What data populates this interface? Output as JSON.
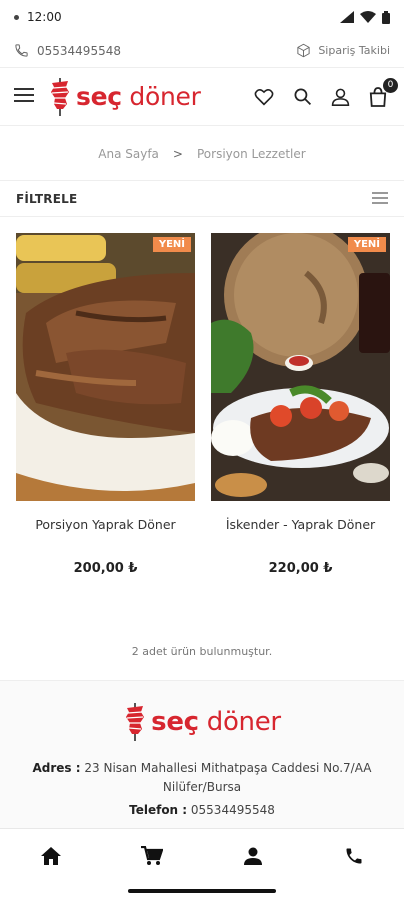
{
  "status_bar": {
    "time": "12:00"
  },
  "topline": {
    "phone": "05534495548",
    "track_label": "Sipariş Takibi"
  },
  "header": {
    "logo_bold": "seç",
    "logo_rest": "döner",
    "cart_count": "0",
    "icons": [
      "menu-icon",
      "heart-icon",
      "search-icon",
      "user-icon",
      "cart-icon"
    ]
  },
  "breadcrumb": {
    "home": "Ana Sayfa",
    "separator": ">",
    "current": "Porsiyon Lezzetler"
  },
  "filter": {
    "label": "FİLTRELE"
  },
  "products": [
    {
      "badge": "YENİ",
      "name": "Porsiyon Yaprak Döner",
      "price": "200,00 ₺"
    },
    {
      "badge": "YENİ",
      "name": "İskender - Yaprak Döner",
      "price": "220,00 ₺"
    }
  ],
  "result_count": "2 adet ürün bulunmuştur.",
  "footer": {
    "logo_bold": "seç",
    "logo_rest": "döner",
    "address_label": "Adres :",
    "address": "23 Nisan Mahallesi Mithatpaşa Caddesi No.7/AA Nilüfer/Bursa",
    "phone_label": "Telefon :",
    "phone": "05534495548"
  },
  "bottom_nav": [
    "home-icon",
    "cart-icon",
    "account-icon",
    "phone-icon"
  ],
  "colors": {
    "brand": "#d7262f",
    "badge": "#f18b4b"
  }
}
